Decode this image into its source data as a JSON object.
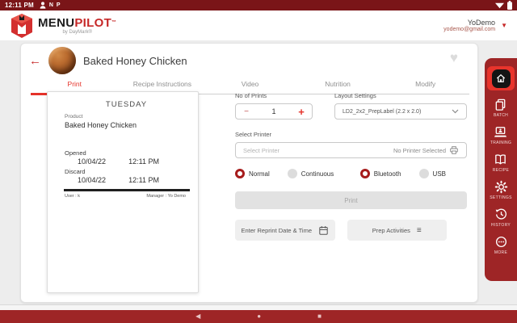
{
  "status_bar": {
    "time": "12:11 PM",
    "notification_letters": {
      "n": "N",
      "p": "P"
    }
  },
  "app_header": {
    "logo": {
      "menu": "MENU",
      "pilot": "PILOT",
      "tm": "™",
      "tagline": "by DayMark®"
    },
    "user": {
      "name": "YoDemo",
      "email": "yodemo@gmail.com"
    }
  },
  "recipe": {
    "title": "Baked Honey Chicken"
  },
  "tabs": [
    {
      "label": "Print",
      "active": true
    },
    {
      "label": "Recipe Instructions",
      "active": false
    },
    {
      "label": "Video",
      "active": false
    },
    {
      "label": "Nutrition",
      "active": false
    },
    {
      "label": "Modify",
      "active": false
    }
  ],
  "label_preview": {
    "day": "TUESDAY",
    "product_label": "Product",
    "product": "Baked Honey Chicken",
    "opened_label": "Opened",
    "opened_date": "10/04/22",
    "opened_time": "12:11 PM",
    "discard_label": "Discard",
    "discard_date": "10/04/22",
    "discard_time": "12:11 PM",
    "user_meta": "User :  k",
    "manager_meta": "Manager :   Yo Demo"
  },
  "print_form": {
    "no_of_prints_label": "No of Prints",
    "prints_value": "1",
    "layout_settings_label": "Layout Settings",
    "layout_value": "LD2_2x2_PrepLabel (2.2 x 2.0)",
    "select_printer_label": "Select Printer",
    "printer_placeholder": "Select Printer",
    "printer_status": "No Printer Selected",
    "radios": [
      {
        "label": "Normal",
        "selected": true
      },
      {
        "label": "Continuous",
        "selected": false
      },
      {
        "label": "Bluetooth",
        "selected": true
      },
      {
        "label": "USB",
        "selected": false
      }
    ],
    "print_button": "Print",
    "reprint_button": "Enter Reprint Date & Time",
    "prep_button": "Prep Activities"
  },
  "sidebar": {
    "items": [
      {
        "name": "home",
        "label": ""
      },
      {
        "name": "batch",
        "label": "BATCH"
      },
      {
        "name": "training",
        "label": "TRAINING"
      },
      {
        "name": "recipe",
        "label": "RECIPE"
      },
      {
        "name": "settings",
        "label": "SETTINGS"
      },
      {
        "name": "history",
        "label": "HISTORY"
      },
      {
        "name": "more",
        "label": "MORE"
      }
    ]
  },
  "icons": {
    "back_arrow": "←",
    "heart": "♥",
    "user_caret": "▼",
    "minus": "−",
    "plus": "+",
    "hamburger": "≡",
    "nav_back": "◀",
    "nav_home": "●",
    "nav_recents": "■"
  },
  "colors": {
    "status_bar": "#7a1518",
    "nav_red": "#9e2526",
    "accent_red": "#e5322a",
    "brand_red": "#c62828",
    "background": "#ededed"
  }
}
